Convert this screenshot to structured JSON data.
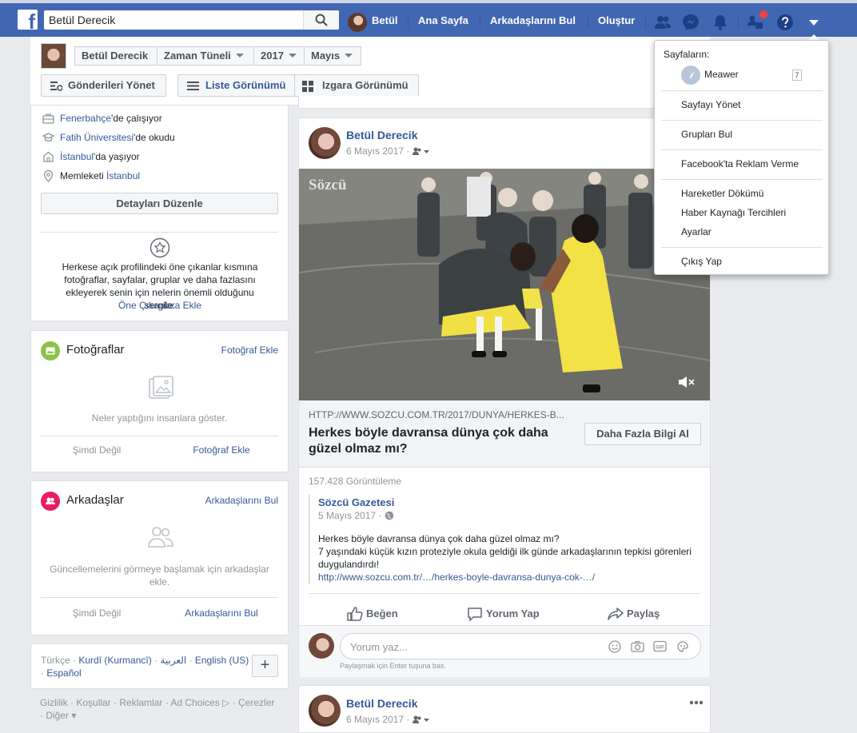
{
  "topbar": {
    "search_value": "Betül Derecik",
    "profile_name": "Betül",
    "nav": [
      "Ana Sayfa",
      "Arkadaşlarını Bul",
      "Oluştur"
    ]
  },
  "subheader": {
    "name": "Betül Derecik",
    "timeline": "Zaman Tüneli",
    "year": "2017",
    "month": "Mayıs",
    "manage_posts": "Gönderileri Yönet",
    "list_view": "Liste Görünümü",
    "grid_view": "Izgara Görünümü"
  },
  "intro": {
    "work_link": "Fenerbahçe",
    "work_suffix": "'de çalışıyor",
    "school_link": "Fatih Üniversitesi",
    "school_suffix": "'de okudu",
    "lives_link": "İstanbul",
    "lives_suffix": "'da yaşıyor",
    "hometown_prefix": "Memleketi ",
    "hometown_link": "İstanbul",
    "edit_details": "Detayları Düzenle",
    "featured_text": "Herkese açık profilindeki öne çıkanlar kısmına fotoğraflar, sayfalar, gruplar ve daha fazlasını ekleyerek senin için nelerin önemli olduğunu sergile.",
    "featured_link": "Öne Çıkanlara Ekle"
  },
  "photos": {
    "title": "Fotoğraflar",
    "add": "Fotoğraf Ekle",
    "empty": "Neler yaptığını insanlara göster.",
    "not_now": "Şimdi Değil",
    "add_bottom": "Fotoğraf Ekle"
  },
  "friends": {
    "title": "Arkadaşlar",
    "find": "Arkadaşlarını Bul",
    "empty": "Güncellemelerini görmeye başlamak için arkadaşlar ekle.",
    "not_now": "Şimdi Değil",
    "find_bottom": "Arkadaşlarını Bul"
  },
  "languages": {
    "line1": [
      "Türkçe",
      "Kurdî (Kurmancî)",
      "العربية",
      "English (US)"
    ],
    "line2": "Español"
  },
  "footer": {
    "line1": [
      "Gizlilik",
      "Koşullar",
      "Reklamlar",
      "Ad Choices",
      "Çerezler"
    ],
    "more": "Diğer"
  },
  "post1": {
    "author": "Betül Derecik",
    "date": "6 Mayıs 2017",
    "watermark": "Sözcü",
    "link_url": "HTTP://WWW.SOZCU.COM.TR/2017/DUNYA/HERKES-B...",
    "link_title": "Herkes böyle davransa dünya çok daha güzel olmaz mı?",
    "learn_more": "Daha Fazla Bilgi Al",
    "views": "157.428 Görüntüleme",
    "orig_author": "Sözcü Gazetesi",
    "orig_date": "5 Mayıs 2017",
    "orig_line1": "Herkes böyle davransa dünya çok daha güzel olmaz mı?",
    "orig_line2": "7 yaşındaki küçük kızın proteziyle okula geldiği ilk günde arkadaşlarının tepkisi görenleri duygulandırdı!",
    "orig_link": "http://www.sozcu.com.tr/…/herkes-boyle-davransa-dunya-cok-…/",
    "like": "Beğen",
    "comment": "Yorum Yap",
    "share": "Paylaş",
    "comment_placeholder": "Yorum yaz...",
    "enter_hint": "Paylaşmak için Enter tuşuna bas."
  },
  "post2": {
    "author": "Betül Derecik",
    "date": "6 Mayıs 2017"
  },
  "dropdown": {
    "pages_header": "Sayfaların:",
    "page_name": "Meawer",
    "page_count": "7",
    "items": [
      "Sayfayı Yönet",
      "Grupları Bul",
      "Facebook'ta Reklam Verme",
      "Hareketler Dökümü",
      "Haber Kaynağı Tercihleri",
      "Ayarlar",
      "Çıkış Yap"
    ]
  },
  "colors": {
    "brand": "#4267b2",
    "link": "#365899",
    "notification": "#fa3e3e"
  }
}
